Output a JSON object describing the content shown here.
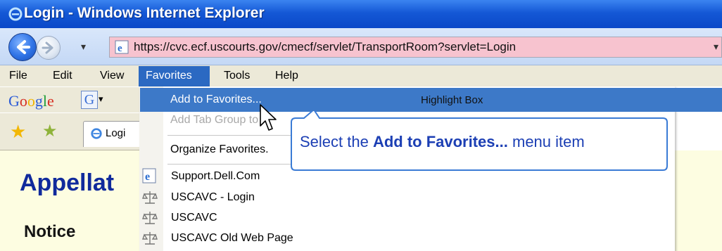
{
  "window": {
    "title": "Login - Windows Internet Explorer"
  },
  "navigation": {
    "address_url": "https://cvc.ecf.uscourts.gov/cmecf/servlet/TransportRoom?servlet=Login",
    "dropdown_glyph": "▾",
    "go_glyph": "▾"
  },
  "menubar": {
    "items": [
      "File",
      "Edit",
      "View",
      "Favorites",
      "Tools",
      "Help"
    ]
  },
  "google_toolbar": {
    "logo_letters": [
      "G",
      "o",
      "o",
      "g",
      "l",
      "e"
    ],
    "logo_colors": [
      "#2a5bd7",
      "#d62d20",
      "#f0b400",
      "#2a5bd7",
      "#1f9d3a",
      "#d62d20"
    ],
    "button_letter": "G",
    "dropdown_glyph": "▾"
  },
  "tab": {
    "label": "Logi"
  },
  "page": {
    "heading": "Appellat",
    "notice": "Notice"
  },
  "favorites_menu": {
    "add_to_favorites": "Add to Favorites...",
    "add_tab_group": "Add Tab Group to F",
    "organize": "Organize Favorites.",
    "links": [
      {
        "label": "Support.Dell.Com",
        "icon": "ie-page-icon"
      },
      {
        "label": "USCAVC - Login",
        "icon": "scales-icon"
      },
      {
        "label": "USCAVC",
        "icon": "scales-icon"
      },
      {
        "label": "USCAVC Old Web Page",
        "icon": "scales-icon"
      }
    ]
  },
  "highlight": {
    "label": "Highlight Box"
  },
  "callout": {
    "prefix": "Select the ",
    "bold": "Add to Favorites...",
    "suffix": " menu item"
  },
  "colors": {
    "titlebar": "#1458d6",
    "menu_highlight": "#3d79c8",
    "address_bar": "#f7c3cf",
    "page_background": "#fdfde1",
    "callout_border": "#3a7bd5",
    "callout_text": "#1c3fb4",
    "heading_text": "#102a9c"
  }
}
